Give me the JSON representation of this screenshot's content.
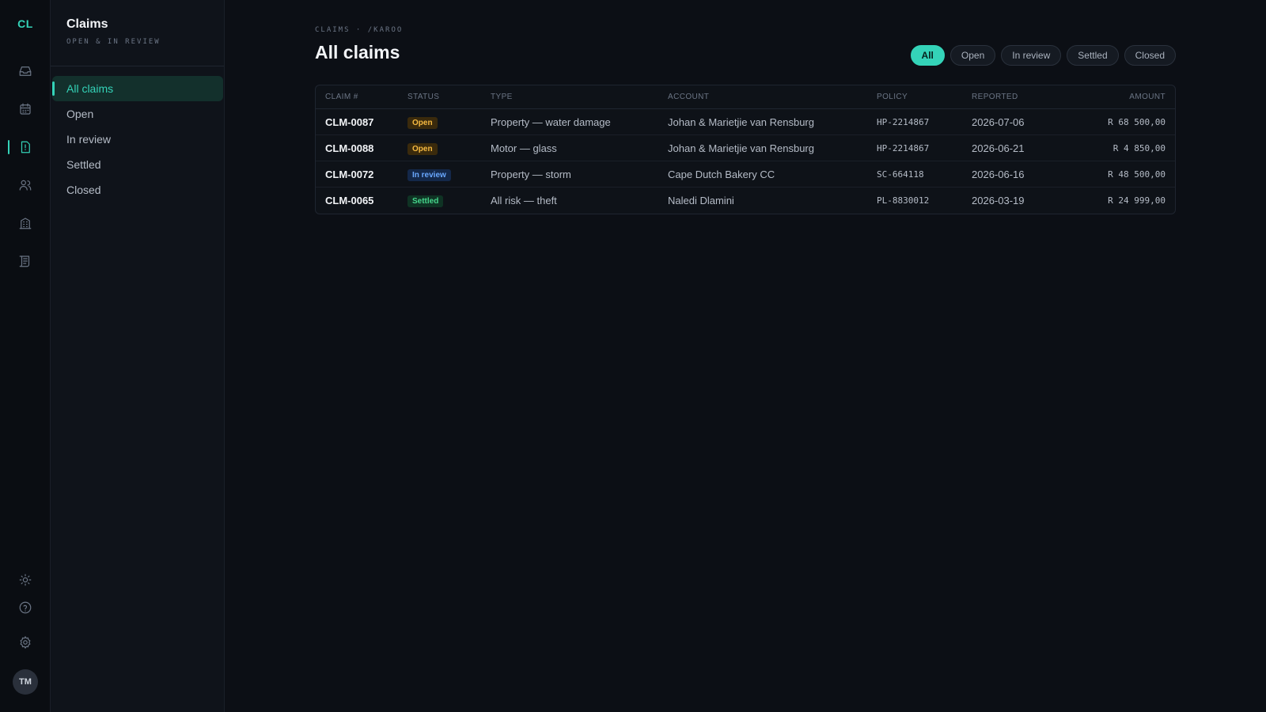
{
  "rail": {
    "logo": "CL",
    "icons": [
      "inbox-icon",
      "calendar-icon",
      "claims-icon",
      "users-icon",
      "building-icon",
      "ledger-icon",
      "theme-icon",
      "help-icon",
      "settings-icon"
    ],
    "avatar": "TM",
    "accent": "#34d3b8"
  },
  "subnav": {
    "title": "Claims",
    "subtitle": "OPEN & IN REVIEW",
    "items": [
      {
        "label": "All claims",
        "active": true
      },
      {
        "label": "Open"
      },
      {
        "label": "In review"
      },
      {
        "label": "Settled"
      },
      {
        "label": "Closed"
      }
    ]
  },
  "main": {
    "breadcrumb": "CLAIMS · /KAROO",
    "title": "All claims",
    "filters": [
      {
        "label": "All",
        "active": true
      },
      {
        "label": "Open"
      },
      {
        "label": "In review"
      },
      {
        "label": "Settled"
      },
      {
        "label": "Closed"
      }
    ],
    "table": {
      "headers": [
        "CLAIM #",
        "STATUS",
        "TYPE",
        "ACCOUNT",
        "POLICY",
        "REPORTED",
        "AMOUNT"
      ],
      "rows": [
        {
          "id": "CLM-0087",
          "status": "Open",
          "type": "Property — water damage",
          "account": "Johan & Marietjie van Rensburg",
          "policy": "HP-2214867",
          "reported": "2026-07-06",
          "amount": "R 68 500,00"
        },
        {
          "id": "CLM-0088",
          "status": "Open",
          "type": "Motor — glass",
          "account": "Johan & Marietjie van Rensburg",
          "policy": "HP-2214867",
          "reported": "2026-06-21",
          "amount": "R 4 850,00"
        },
        {
          "id": "CLM-0072",
          "status": "In review",
          "type": "Property — storm",
          "account": "Cape Dutch Bakery CC",
          "policy": "SC-664118",
          "reported": "2026-06-16",
          "amount": "R 48 500,00"
        },
        {
          "id": "CLM-0065",
          "status": "Settled",
          "type": "All risk — theft",
          "account": "Naledi Dlamini",
          "policy": "PL-8830012",
          "reported": "2026-03-19",
          "amount": "R 24 999,00"
        }
      ]
    },
    "status_colors": {
      "Open": "#f5b941",
      "In review": "#6aa8ff",
      "Settled": "#46d68c"
    }
  }
}
